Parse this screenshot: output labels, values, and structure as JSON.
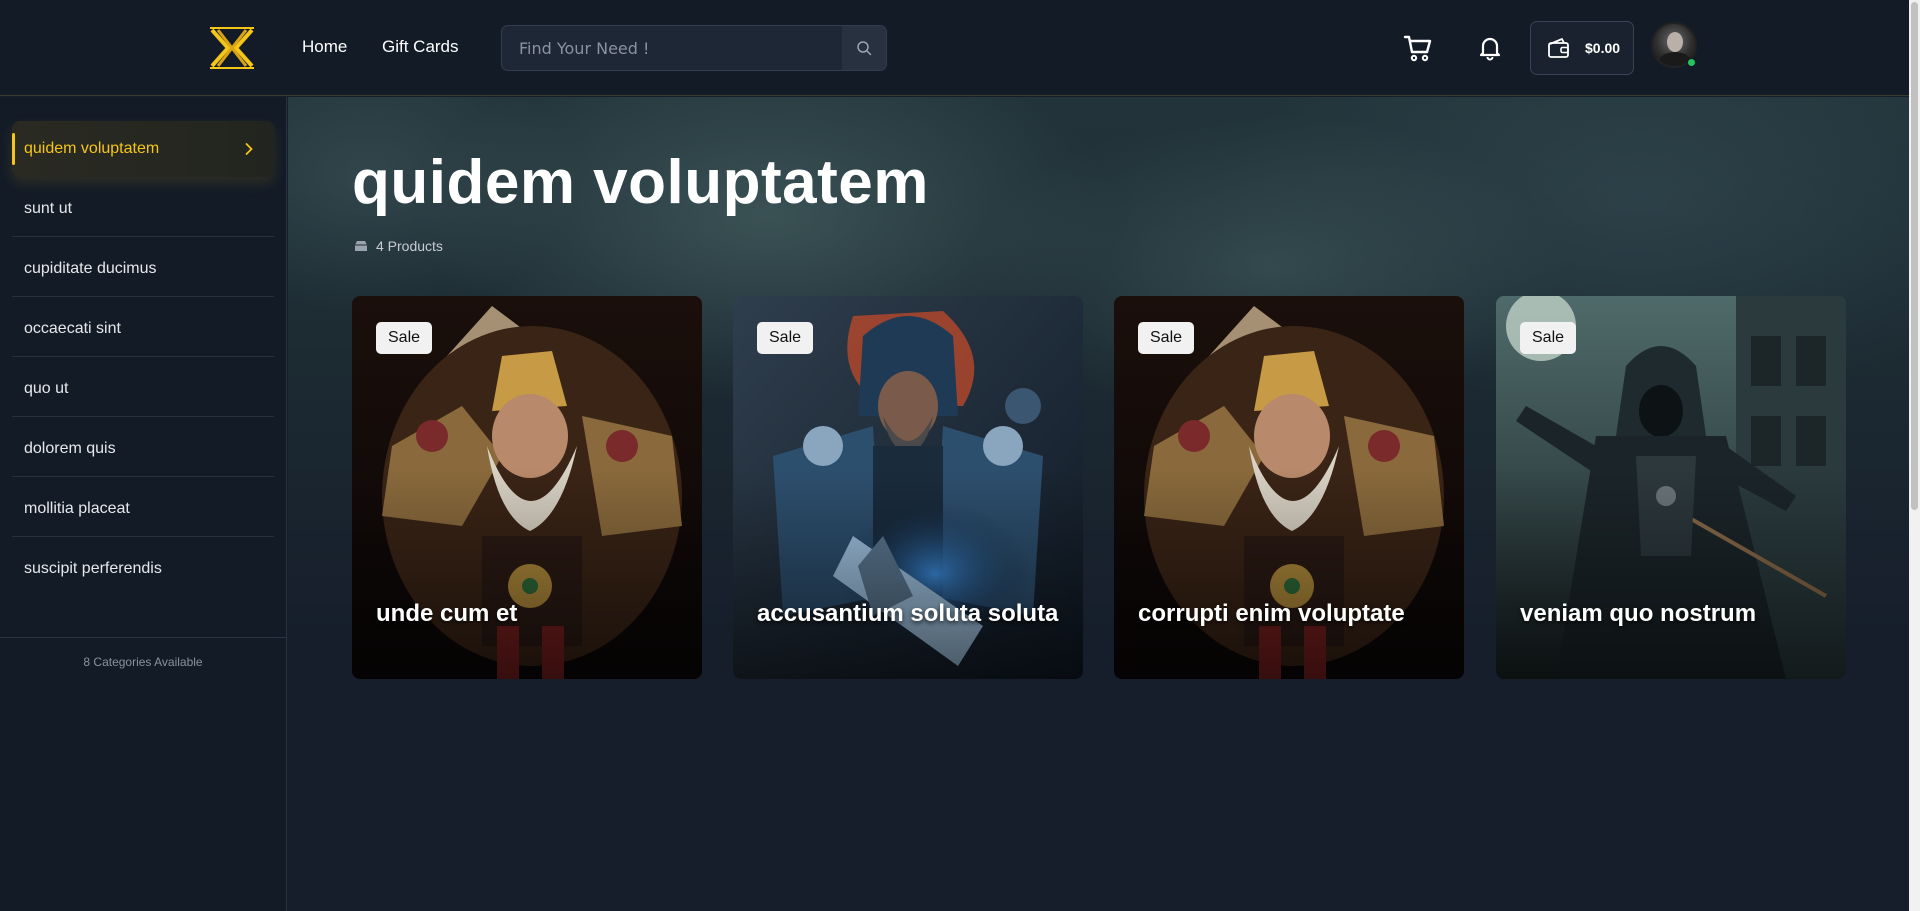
{
  "header": {
    "nav": [
      {
        "label": "Home"
      },
      {
        "label": "Gift Cards"
      }
    ],
    "search": {
      "placeholder": "Find Your Need !"
    },
    "wallet": {
      "amount": "$0.00"
    },
    "colors": {
      "accent": "#f5c518",
      "online": "#22c55e"
    }
  },
  "sidebar": {
    "items": [
      {
        "label": "quidem voluptatem",
        "active": true
      },
      {
        "label": "sunt ut"
      },
      {
        "label": "cupiditate ducimus"
      },
      {
        "label": "occaecati sint"
      },
      {
        "label": "quo ut"
      },
      {
        "label": "dolorem quis"
      },
      {
        "label": "mollitia placeat"
      },
      {
        "label": "suscipit perferendis"
      }
    ],
    "footer": "8 Categories Available"
  },
  "main": {
    "title": "quidem voluptatem",
    "product_count": "4 Products",
    "products": [
      {
        "title": "unde cum et",
        "badge": "Sale",
        "art": "warrior-dwarf"
      },
      {
        "title": "accusantium soluta soluta",
        "badge": "Sale",
        "art": "armored-knight-blue"
      },
      {
        "title": "corrupti enim voluptate",
        "badge": "Sale",
        "art": "warrior-dwarf"
      },
      {
        "title": "veniam quo nostrum",
        "badge": "Sale",
        "art": "hooded-assassin"
      }
    ]
  }
}
